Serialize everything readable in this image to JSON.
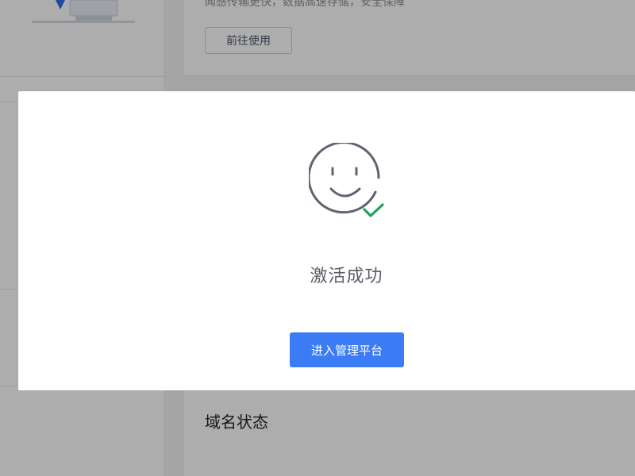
{
  "background": {
    "feature_description": "闻感传输更快，数据高速存储，安全保障",
    "goto_button_label": "前往使用",
    "domain_status_title": "域名状态"
  },
  "modal": {
    "icon": "smiley-check-icon",
    "title": "激活成功",
    "primary_button_label": "进入管理平台"
  },
  "colors": {
    "accent": "#3b7cf5",
    "success": "#1aa35a",
    "icon_stroke": "#5f6470"
  }
}
